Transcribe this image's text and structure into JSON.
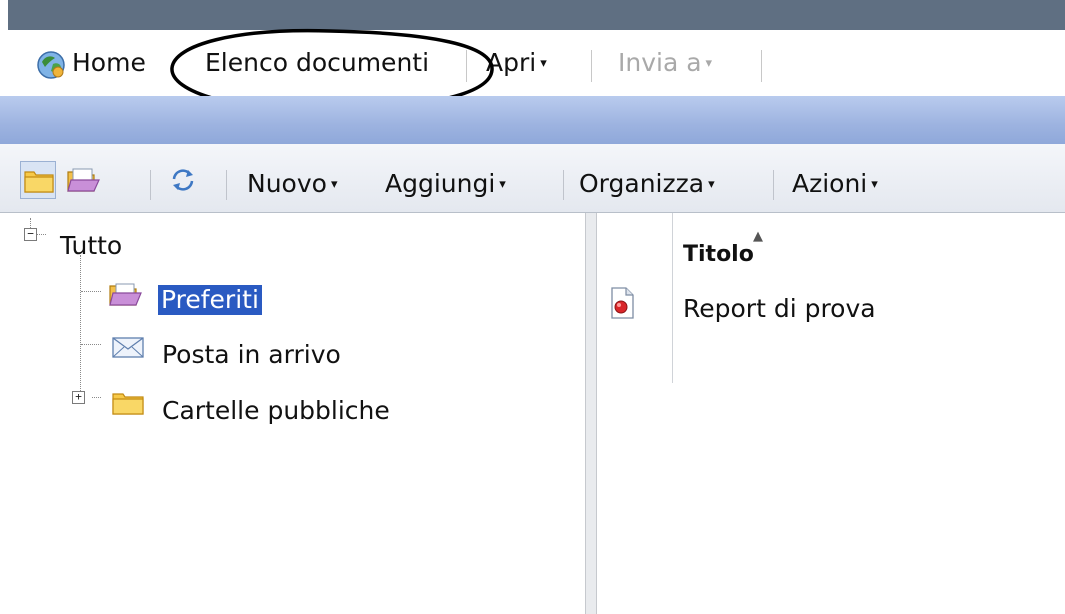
{
  "menubar": {
    "home_label": "Home",
    "document_list_label": "Elenco documenti",
    "open_label": "Apri",
    "send_to_label": "Invia a",
    "caret_glyph": "▾"
  },
  "toolbar": {
    "new_label": "Nuovo",
    "add_label": "Aggiungi",
    "organize_label": "Organizza",
    "actions_label": "Azioni",
    "caret_glyph": "▾"
  },
  "tree": {
    "root_label": "Tutto",
    "root_expander": "−",
    "items": [
      {
        "label": "Preferiti",
        "icon": "open-folder-icon",
        "selected": true
      },
      {
        "label": "Posta in arrivo",
        "icon": "inbox-icon",
        "selected": false
      },
      {
        "label": "Cartelle pubbliche",
        "icon": "folder-icon",
        "selected": false,
        "expander": "+"
      }
    ]
  },
  "list": {
    "column_title": "Titolo",
    "sort_glyph": "▲",
    "rows": [
      {
        "title": "Report di prova",
        "icon": "report-icon"
      }
    ]
  },
  "colors": {
    "topbar": "#5f6f82",
    "selection": "#2a5ac2",
    "band": "#9db3e0"
  }
}
